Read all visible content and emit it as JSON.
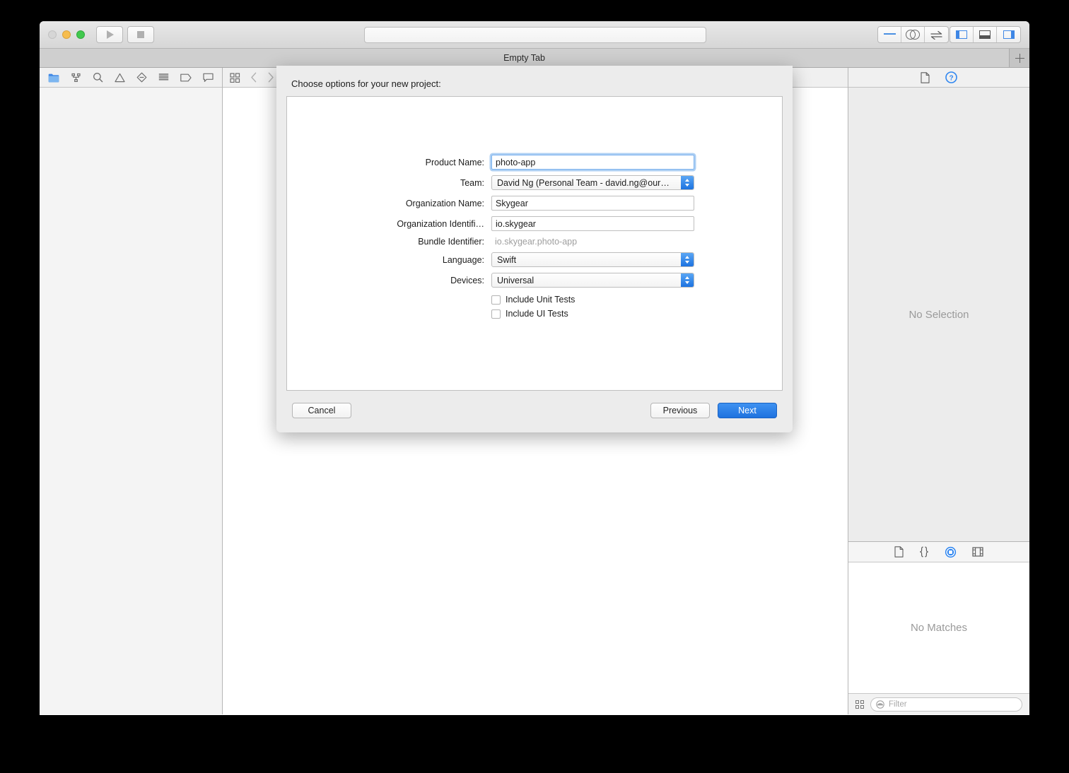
{
  "window": {
    "traffic_lights": [
      "close",
      "minimize",
      "zoom"
    ],
    "toolbar": {
      "run_label": "Run",
      "stop_label": "Stop",
      "activity_text": "",
      "editor_modes": [
        "standard-editor",
        "assistant-editor",
        "version-editor"
      ],
      "panel_toggles": [
        "navigator-panel",
        "debug-panel",
        "utilities-panel"
      ]
    },
    "tabbar": {
      "tab_label": "Empty Tab",
      "add_tab_label": "+"
    }
  },
  "navigator": {
    "tabs": [
      "project-navigator",
      "source-control-navigator",
      "find-navigator",
      "issue-navigator",
      "test-navigator",
      "debug-navigator",
      "breakpoint-navigator",
      "report-navigator"
    ],
    "selected": "project-navigator"
  },
  "editor": {
    "jumpbar_icons": [
      "related-items",
      "go-back",
      "go-forward"
    ],
    "content": ""
  },
  "inspector": {
    "tabs": [
      "file-inspector",
      "quick-help-inspector"
    ],
    "selected": "quick-help-inspector",
    "empty_message": "No Selection"
  },
  "library": {
    "tabs": [
      "file-template-library",
      "code-snippet-library",
      "object-library",
      "media-library"
    ],
    "selected": "object-library",
    "empty_message": "No Matches",
    "filter_placeholder": "Filter",
    "filter_value": ""
  },
  "sheet": {
    "title": "Choose options for your new project:",
    "fields": [
      {
        "label": "Product Name:",
        "type": "text",
        "value": "photo-app",
        "focused": true
      },
      {
        "label": "Team:",
        "type": "popup",
        "value": "David Ng (Personal Team - david.ng@our…"
      },
      {
        "label": "Organization Name:",
        "type": "text",
        "value": "Skygear",
        "focused": false
      },
      {
        "label": "Organization Identifi…",
        "type": "text",
        "value": "io.skygear",
        "focused": false
      },
      {
        "label": "Bundle Identifier:",
        "type": "static",
        "value": "io.skygear.photo-app"
      },
      {
        "label": "Language:",
        "type": "popup",
        "value": "Swift"
      },
      {
        "label": "Devices:",
        "type": "popup",
        "value": "Universal"
      }
    ],
    "checkboxes": [
      {
        "label": "Include Unit Tests",
        "checked": false
      },
      {
        "label": "Include UI Tests",
        "checked": false
      }
    ],
    "buttons": {
      "cancel": "Cancel",
      "previous": "Previous",
      "next": "Next"
    }
  },
  "colors": {
    "accent_blue": "#1d73e0",
    "selected_icon_blue": "#3f87e5",
    "focus_ring": "#7fb4ef",
    "placeholder_gray": "#9a9a9a"
  }
}
